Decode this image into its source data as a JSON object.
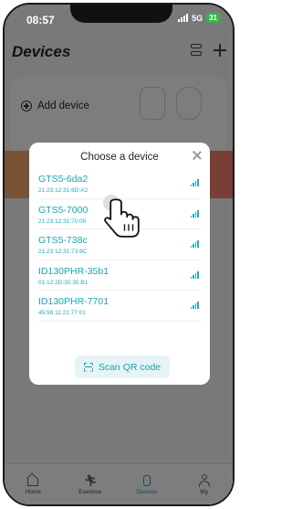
{
  "status_bar": {
    "time": "08:57",
    "network": "5G",
    "battery": "31"
  },
  "header": {
    "title": "Devices",
    "icons": [
      "list-icon",
      "plus-icon"
    ]
  },
  "add_device": {
    "label": "Add device",
    "icon": "circle-plus-icon"
  },
  "dialog": {
    "title": "Choose a device",
    "close_icon": "close-icon",
    "devices": [
      {
        "name": "GTS5-6da2",
        "mac": "21:23:12:31:6D:A2"
      },
      {
        "name": "GTS5-7000",
        "mac": "21:23:12:31:70:00"
      },
      {
        "name": "GTS5-738c",
        "mac": "21:23:12:31:73:8C"
      },
      {
        "name": "ID130PHR-35b1",
        "mac": "01:12:2D:35:35:B1"
      },
      {
        "name": "ID130PHR-7701",
        "mac": "45:98:11:21:77:01"
      }
    ],
    "scan_button": {
      "label": "Scan QR code",
      "icon": "qr-scan-icon"
    }
  },
  "tab_bar": {
    "tabs": [
      {
        "label": "Home",
        "icon": "home-icon"
      },
      {
        "label": "Exercise",
        "icon": "running-icon"
      },
      {
        "label": "Devices",
        "icon": "watch-icon",
        "active": true
      },
      {
        "label": "My",
        "icon": "person-icon"
      }
    ]
  },
  "colors": {
    "accent": "#1aa4b3",
    "overlay": "#00000080",
    "battery": "#3bb34a"
  }
}
